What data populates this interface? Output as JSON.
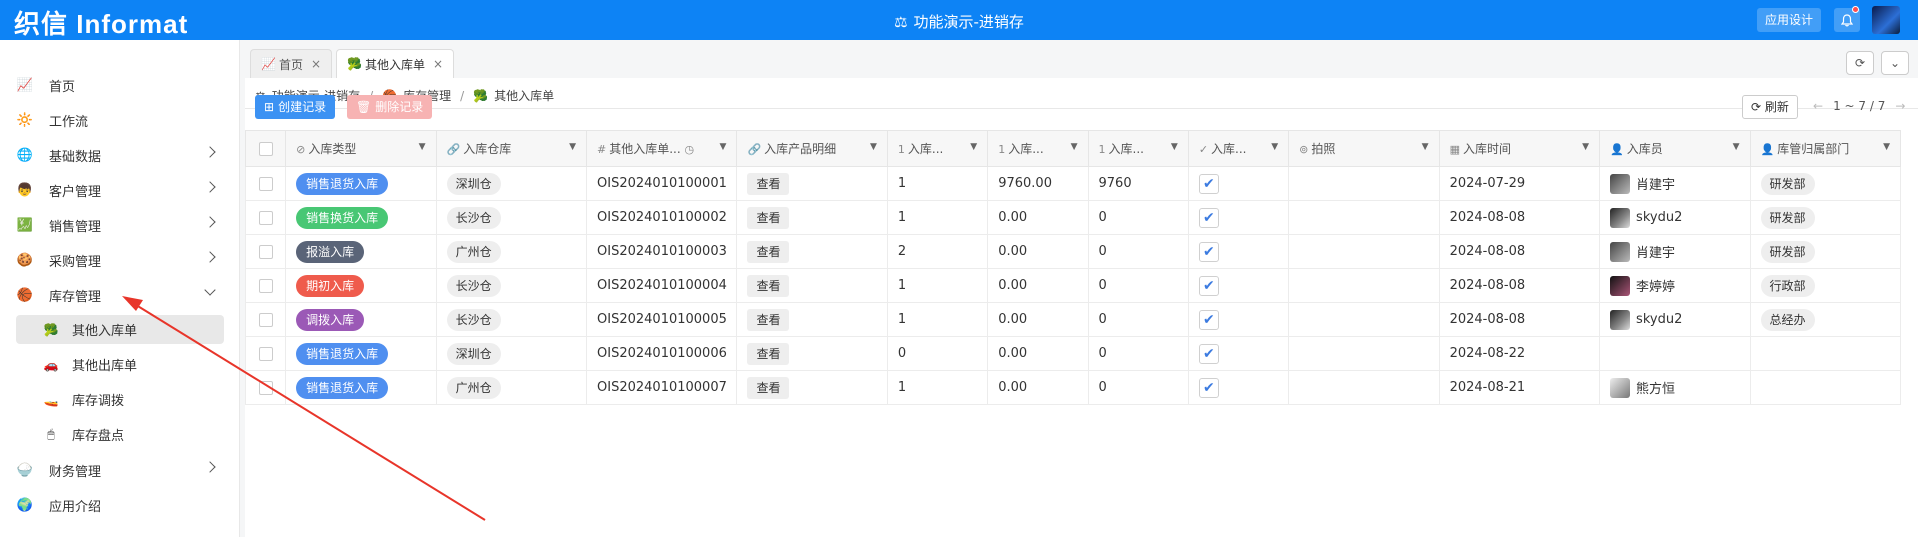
{
  "header": {
    "logo": "织信 Informat",
    "title": "功能演示-进销存",
    "app_design_label": "应用设计"
  },
  "sidebar": {
    "items": [
      {
        "label": "首页",
        "icon": "chart-icon"
      },
      {
        "label": "工作流",
        "icon": "sun-icon"
      },
      {
        "label": "基础数据",
        "icon": "globe-icon"
      },
      {
        "label": "客户管理",
        "icon": "person-icon"
      },
      {
        "label": "销售管理",
        "icon": "chart-up-icon"
      },
      {
        "label": "采购管理",
        "icon": "cookie-icon"
      },
      {
        "label": "库存管理",
        "icon": "basketball-icon"
      },
      {
        "label": "财务管理",
        "icon": "bowl-icon"
      },
      {
        "label": "应用介绍",
        "icon": "globe-icon"
      }
    ],
    "subitems": [
      {
        "label": "其他入库单",
        "icon": "broccoli-icon"
      },
      {
        "label": "其他出库单",
        "icon": "car-icon"
      },
      {
        "label": "库存调拨",
        "icon": "boat-icon"
      },
      {
        "label": "库存盘点",
        "icon": "mouse-icon"
      }
    ]
  },
  "tabs": [
    {
      "label": "首页"
    },
    {
      "label": "其他入库单"
    }
  ],
  "breadcrumb": [
    "功能演示-进销存",
    "库存管理",
    "其他入库单"
  ],
  "toolbar": {
    "create_label": "创建记录",
    "delete_label": "删除记录",
    "refresh_label": "刷新",
    "pager_text": "1 ~ 7 / 7"
  },
  "table": {
    "columns": [
      "入库类型",
      "入库仓库",
      "其他入库单...",
      "入库产品明细",
      "入库...",
      "入库...",
      "入库...",
      "入库...",
      "拍照",
      "入库时间",
      "入库员",
      "库管归属部门"
    ],
    "rows": [
      {
        "type": "销售退货入库",
        "type_color": "#4f8ff0",
        "warehouse": "深圳仓",
        "code": "OIS2024010100001",
        "detail": "查看",
        "q1": "1",
        "q2": "9760.00",
        "q3": "9760",
        "checked": true,
        "date": "2024-07-29",
        "user": "肖建宇",
        "dept": "研发部"
      },
      {
        "type": "销售换货入库",
        "type_color": "#48c774",
        "warehouse": "长沙仓",
        "code": "OIS2024010100002",
        "detail": "查看",
        "q1": "1",
        "q2": "0.00",
        "q3": "0",
        "checked": true,
        "date": "2024-08-08",
        "user": "skydu2",
        "dept": "研发部"
      },
      {
        "type": "报溢入库",
        "type_color": "#5a6478",
        "warehouse": "广州仓",
        "code": "OIS2024010100003",
        "detail": "查看",
        "q1": "2",
        "q2": "0.00",
        "q3": "0",
        "checked": true,
        "date": "2024-08-08",
        "user": "肖建宇",
        "dept": "研发部"
      },
      {
        "type": "期初入库",
        "type_color": "#ef5b4c",
        "warehouse": "长沙仓",
        "code": "OIS2024010100004",
        "detail": "查看",
        "q1": "1",
        "q2": "0.00",
        "q3": "0",
        "checked": true,
        "date": "2024-08-08",
        "user": "李婷婷",
        "dept": "行政部"
      },
      {
        "type": "调拨入库",
        "type_color": "#9b59b6",
        "warehouse": "长沙仓",
        "code": "OIS2024010100005",
        "detail": "查看",
        "q1": "1",
        "q2": "0.00",
        "q3": "0",
        "checked": true,
        "date": "2024-08-08",
        "user": "skydu2",
        "dept": "总经办"
      },
      {
        "type": "销售退货入库",
        "type_color": "#4f8ff0",
        "warehouse": "深圳仓",
        "code": "OIS2024010100006",
        "detail": "查看",
        "q1": "0",
        "q2": "0.00",
        "q3": "0",
        "checked": true,
        "date": "2024-08-22",
        "user": "",
        "dept": ""
      },
      {
        "type": "销售退货入库",
        "type_color": "#4f8ff0",
        "warehouse": "广州仓",
        "code": "OIS2024010100007",
        "detail": "查看",
        "q1": "1",
        "q2": "0.00",
        "q3": "0",
        "checked": true,
        "date": "2024-08-21",
        "user": "熊方恒",
        "dept": ""
      }
    ]
  }
}
